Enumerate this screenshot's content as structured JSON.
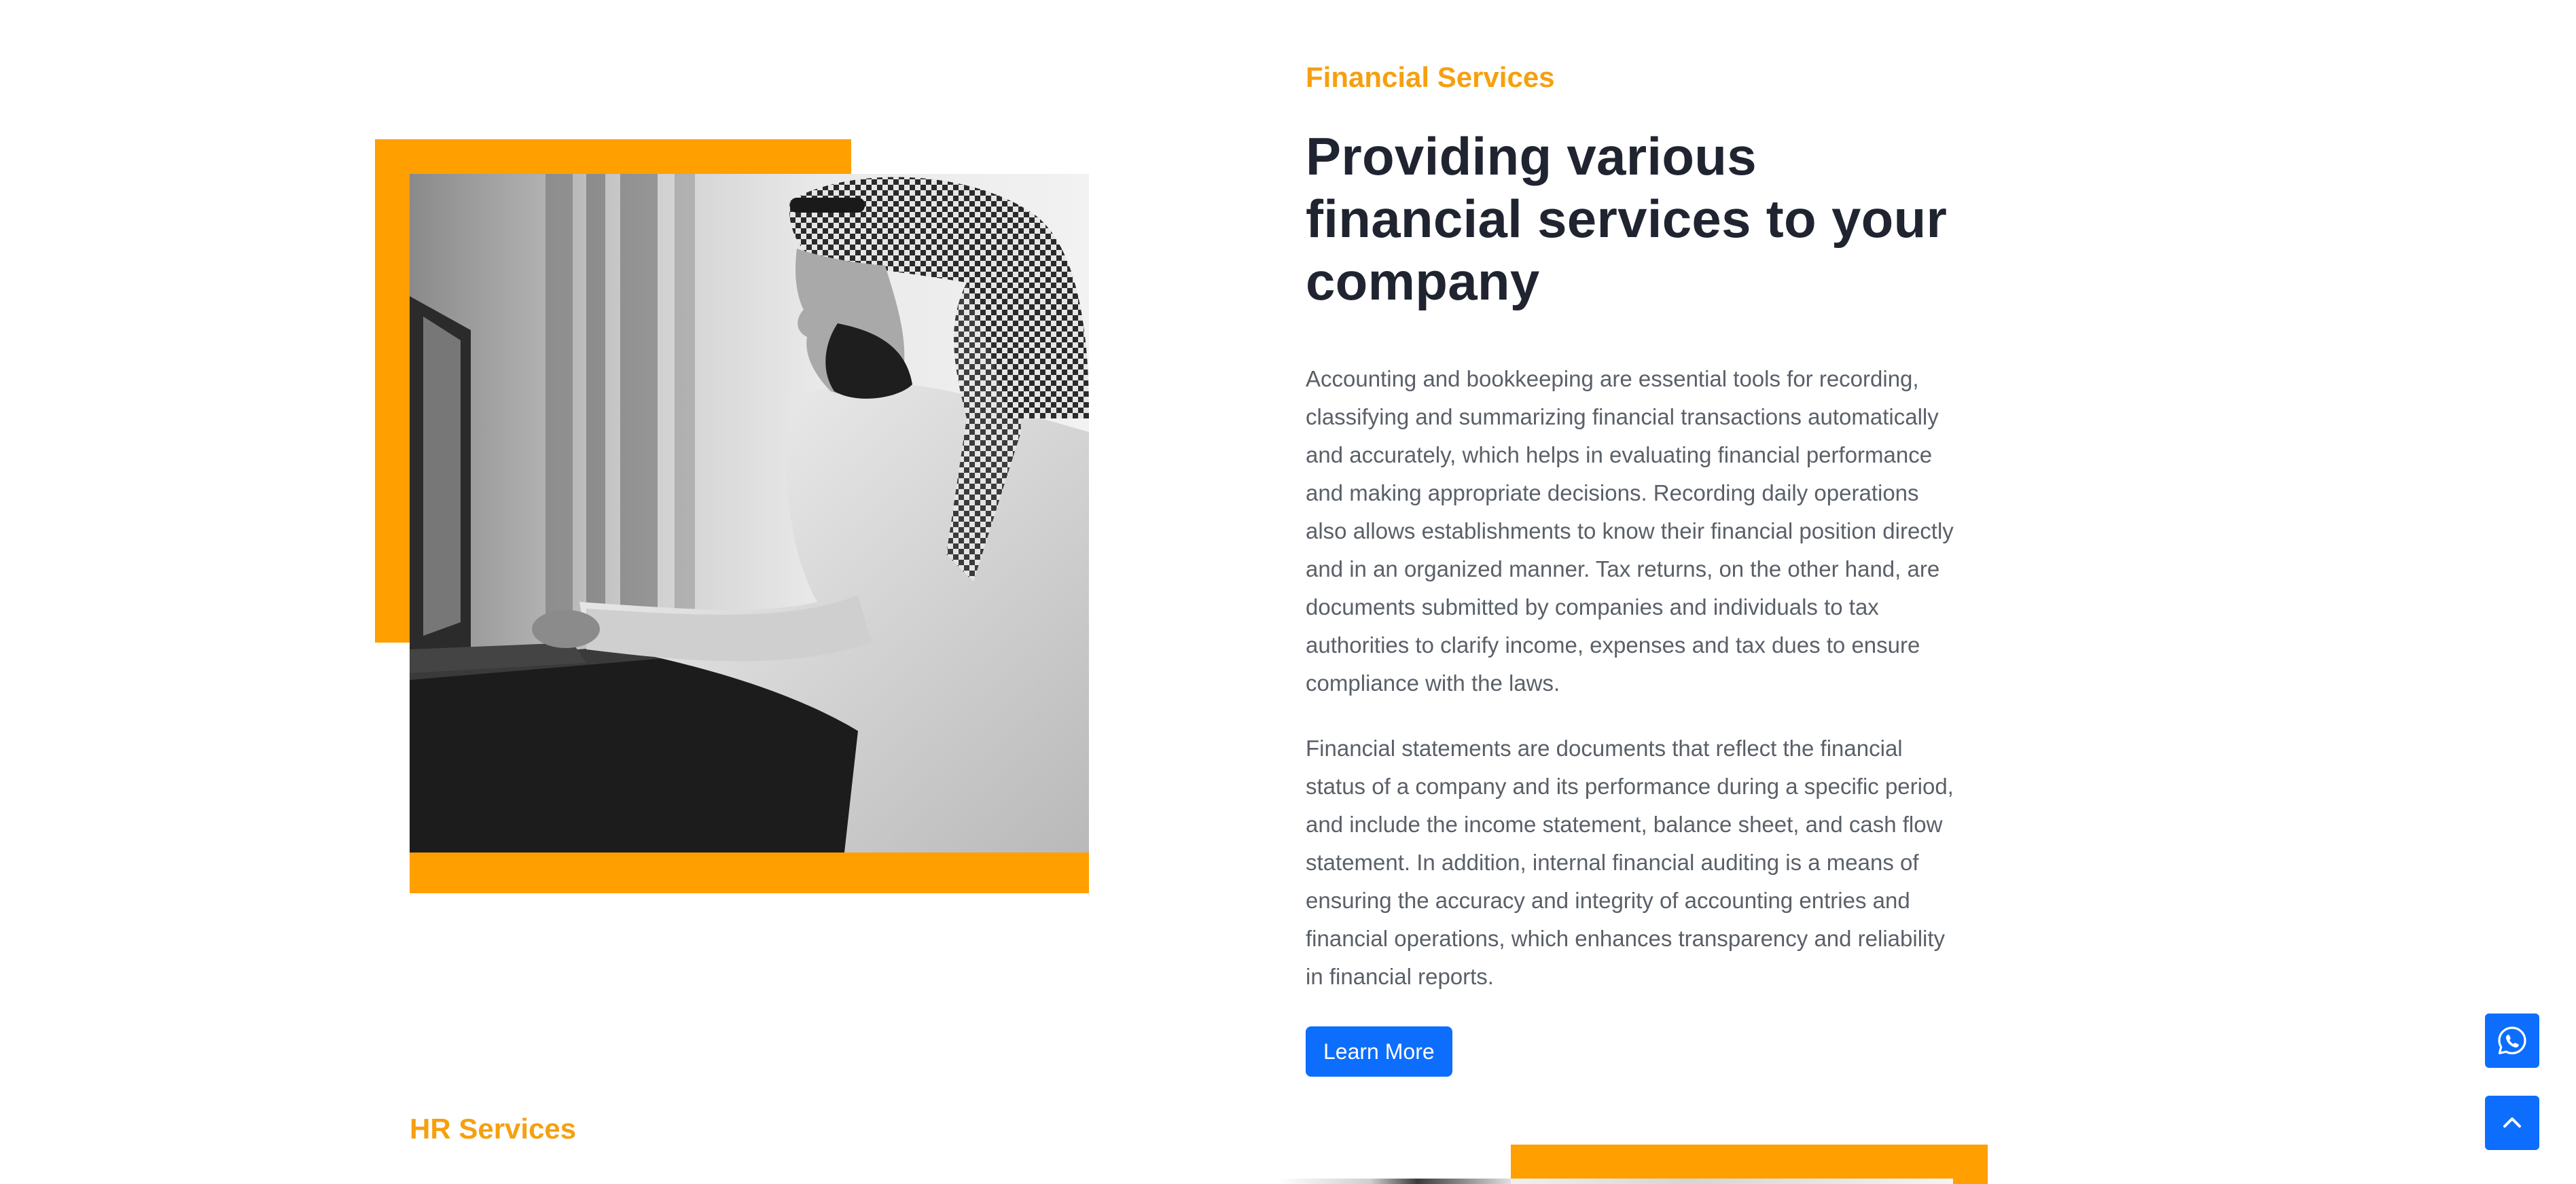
{
  "financial": {
    "eyebrow": "Financial Services",
    "heading": "Providing various financial services to your company",
    "paragraph_1": "Accounting and bookkeeping are essential tools for recording, classifying and summarizing financial transactions automatically and accurately, which helps in evaluating financial performance and making appropriate decisions. Recording daily operations also allows establishments to know their financial position directly and in an organized manner. Tax returns, on the other hand, are documents submitted by companies and individuals to tax authorities to clarify income, expenses and tax dues to ensure compliance with the laws.",
    "paragraph_2": "Financial statements are documents that reflect the financial status of a company and its performance during a specific period, and include the income statement, balance sheet, and cash flow statement. In addition, internal financial auditing is a means of ensuring the accuracy and integrity of accounting entries and financial operations, which enhances transparency and reliability in financial reports.",
    "button_label": "Learn More"
  },
  "hr": {
    "eyebrow": "HR Services"
  },
  "floating": {
    "whatsapp_icon": "whatsapp-icon",
    "top_icon": "chevron-up-icon"
  },
  "colors": {
    "accent": "#FF9F00",
    "eyebrow": "#F5A00F",
    "heading": "#1f2430",
    "body_text": "#5a6068",
    "button": "#0D6EFD"
  }
}
